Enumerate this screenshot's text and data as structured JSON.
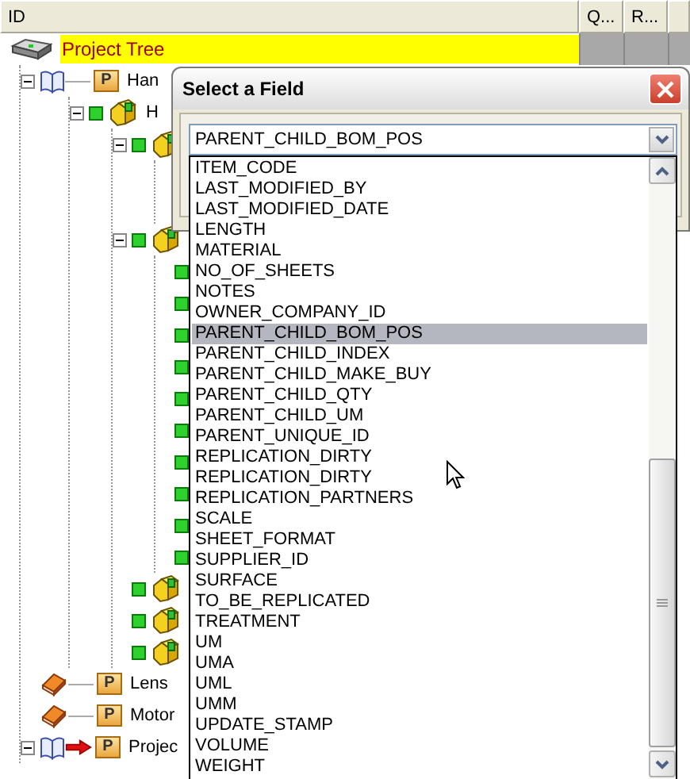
{
  "columns": [
    {
      "label": "ID"
    },
    {
      "label": "Q..."
    },
    {
      "label": "R..."
    },
    {}
  ],
  "tree": [
    {
      "kind": "root",
      "label": "Project Tree",
      "selected": true,
      "children": [
        {
          "kind": "assembly",
          "tag": "P",
          "label": "Han",
          "selected": false,
          "expanded": true,
          "children": [
            {
              "kind": "part",
              "label": "H",
              "selected": false,
              "expanded": true,
              "children": [
                {
                  "kind": "part",
                  "expanded": true,
                  "children": [
                    {
                      "kind": "covered"
                    },
                    {
                      "kind": "covered"
                    }
                  ]
                },
                {
                  "kind": "part",
                  "expanded": true,
                  "children": [
                    {
                      "kind": "status"
                    },
                    {
                      "kind": "status"
                    },
                    {
                      "kind": "status"
                    },
                    {
                      "kind": "status"
                    },
                    {
                      "kind": "status"
                    },
                    {
                      "kind": "status"
                    },
                    {
                      "kind": "status"
                    },
                    {
                      "kind": "status"
                    },
                    {
                      "kind": "status"
                    },
                    {
                      "kind": "status"
                    }
                  ]
                },
                {
                  "kind": "part"
                },
                {
                  "kind": "part"
                },
                {
                  "kind": "part"
                }
              ]
            }
          ]
        },
        {
          "kind": "document",
          "tag": "P",
          "label": "Lens",
          "selected": false
        },
        {
          "kind": "document",
          "tag": "P",
          "label": "Motor",
          "selected": false
        },
        {
          "kind": "assembly",
          "tag": "P",
          "label": "Projec",
          "selected": false,
          "expanded": true,
          "current": true
        }
      ]
    }
  ],
  "dialog": {
    "title": "Select a Field",
    "value": "PARENT_CHILD_BOM_POS",
    "fields": [
      {
        "label": "ITEM_CODE",
        "selected": false
      },
      {
        "label": "LAST_MODIFIED_BY",
        "selected": false
      },
      {
        "label": "LAST_MODIFIED_DATE",
        "selected": false
      },
      {
        "label": "LENGTH",
        "selected": false
      },
      {
        "label": "MATERIAL",
        "selected": false
      },
      {
        "label": "NO_OF_SHEETS",
        "selected": false
      },
      {
        "label": "NOTES",
        "selected": false
      },
      {
        "label": "OWNER_COMPANY_ID",
        "selected": false
      },
      {
        "label": "PARENT_CHILD_BOM_POS",
        "selected": true
      },
      {
        "label": "PARENT_CHILD_INDEX",
        "selected": false
      },
      {
        "label": "PARENT_CHILD_MAKE_BUY",
        "selected": false
      },
      {
        "label": "PARENT_CHILD_QTY",
        "selected": false
      },
      {
        "label": "PARENT_CHILD_UM",
        "selected": false
      },
      {
        "label": "PARENT_UNIQUE_ID",
        "selected": false
      },
      {
        "label": "REPLICATION_DIRTY",
        "selected": false
      },
      {
        "label": "REPLICATION_DIRTY",
        "selected": false
      },
      {
        "label": "REPLICATION_PARTNERS",
        "selected": false
      },
      {
        "label": "SCALE",
        "selected": false
      },
      {
        "label": "SHEET_FORMAT",
        "selected": false
      },
      {
        "label": "SUPPLIER_ID",
        "selected": false
      },
      {
        "label": "SURFACE",
        "selected": false
      },
      {
        "label": "TO_BE_REPLICATED",
        "selected": false
      },
      {
        "label": "TREATMENT",
        "selected": false
      },
      {
        "label": "UM",
        "selected": false
      },
      {
        "label": "UMA",
        "selected": false
      },
      {
        "label": "UML",
        "selected": false
      },
      {
        "label": "UMM",
        "selected": false
      },
      {
        "label": "UPDATE_STAMP",
        "selected": false
      },
      {
        "label": "VOLUME",
        "selected": false
      },
      {
        "label": "WEIGHT",
        "selected": false
      }
    ]
  }
}
